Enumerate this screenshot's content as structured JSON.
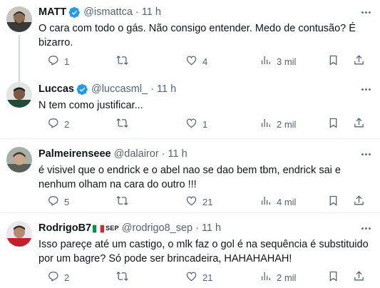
{
  "tweets": [
    {
      "name": "MATT",
      "verified": true,
      "handle": "@ismattca",
      "dot": "·",
      "time": "11 h",
      "text": "O cara com todo o gás. Não consigo entender. Medo de contusão? É bizarro.",
      "replies": "1",
      "retweets": "",
      "likes": "4",
      "views": "3 mil"
    },
    {
      "name": "Luccas",
      "verified": true,
      "handle": "@luccasml_",
      "dot": "·",
      "time": "11 h",
      "text": "N tem como justificar...",
      "replies": "2",
      "retweets": "",
      "likes": "1",
      "views": "2 mil"
    },
    {
      "name": "Palmeirenseee",
      "verified": false,
      "handle": "@dalairor",
      "dot": "·",
      "time": "11 h",
      "text": "é visivel que o endrick e o abel nao se dao bem tbm, endrick sai e nenhum olham na cara do outro !!!",
      "replies": "5",
      "retweets": "",
      "likes": "21",
      "views": "4 mil"
    },
    {
      "name": "RodrigoB7",
      "flag": "italy-flag",
      "name_tag": "SEP",
      "verified": false,
      "handle": "@rodrigo8_sep",
      "dot": "·",
      "time": "11 h",
      "text": "Isso pareçe até um castigo, o mlk faz o gol é na sequência é substituido por um bagre? Só pode ser brincadeira, HAHAHAHAH!",
      "replies": "2",
      "retweets": "",
      "likes": "21",
      "views": "2 mil"
    }
  ],
  "colors": {
    "verified": "#1d9bf0",
    "secondary_text": "#536471",
    "primary_text": "#0f1419",
    "divider": "#eff3f4",
    "thread_line": "#cfd9de"
  },
  "icons": [
    "more-icon",
    "reply-icon",
    "retweet-icon",
    "like-icon",
    "views-icon",
    "bookmark-icon",
    "share-icon",
    "verified-badge-icon",
    "italy-flag-icon"
  ]
}
